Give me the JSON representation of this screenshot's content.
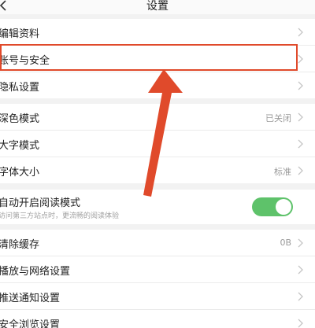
{
  "header": {
    "title": "设置",
    "back_icon": "chevron-left-icon"
  },
  "rows": [
    {
      "label": "编辑资料",
      "value": ""
    },
    {
      "label": "账号与安全",
      "value": ""
    },
    {
      "label": "隐私设置",
      "value": ""
    },
    {
      "label": "深色模式",
      "value": "已关闭"
    },
    {
      "label": "大字模式",
      "value": ""
    },
    {
      "label": "字体大小",
      "value": "标准"
    },
    {
      "label": "自动开启阅读模式",
      "sub": "访问第三方站点时，更流畅的阅读体验",
      "toggle_on": true
    },
    {
      "label": "清除缓存",
      "value": "0B"
    },
    {
      "label": "播放与网络设置",
      "value": ""
    },
    {
      "label": "推送通知设置",
      "value": ""
    },
    {
      "label": "安全浏览设置",
      "value": ""
    }
  ],
  "colors": {
    "toggle_on": "#5ec26a",
    "annotation": "#e04a2b"
  }
}
